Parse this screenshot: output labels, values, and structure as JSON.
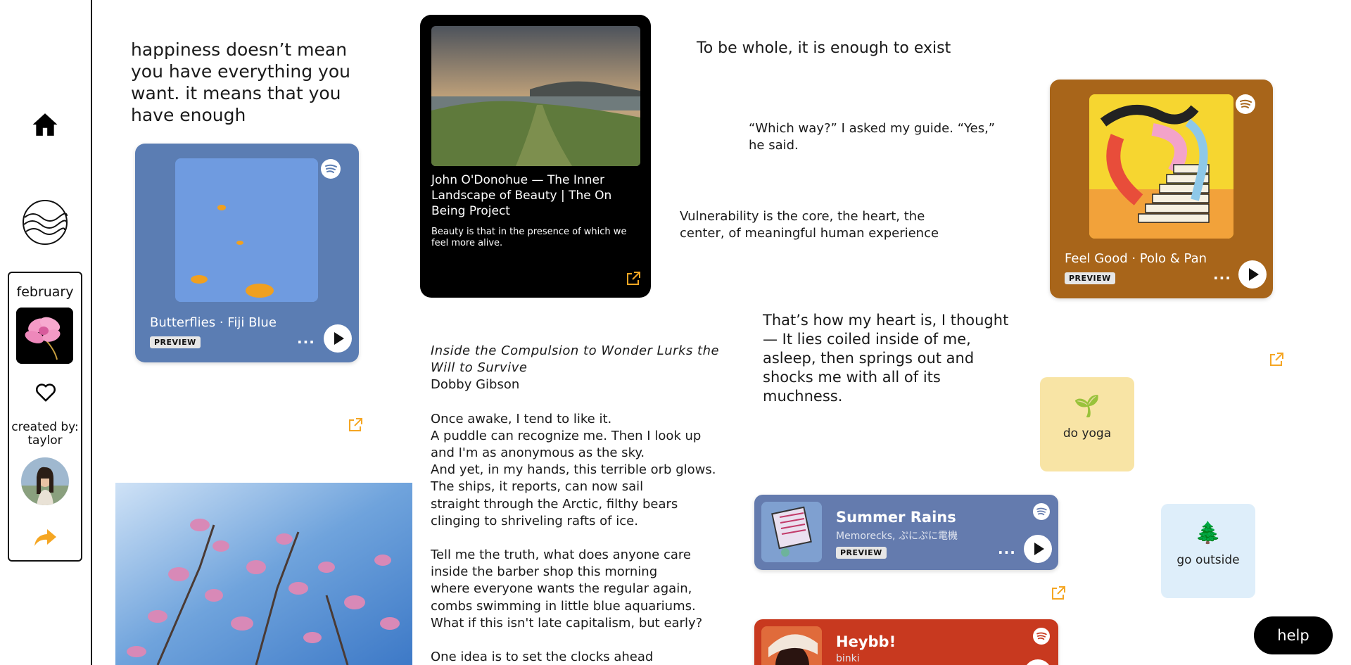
{
  "sidebar": {
    "month": "february",
    "created_by": "created by: taylor"
  },
  "quotes": {
    "happiness": "happiness doesn’t mean you have everything you want. it means that you have enough",
    "whole": "To be whole, it is enough to exist",
    "which_way": "“Which way?” I asked my guide. “Yes,” he said.",
    "vulnerability": "Vulnerability is the core, the heart, the center, of meaningful human experience",
    "heart": "That’s how my heart is, I thought— It lies coiled inside of me, asleep, then springs out and shocks me with all of its muchness."
  },
  "spotify": {
    "butterflies": {
      "title": "Butterflies · Fiji Blue",
      "badge": "PREVIEW"
    },
    "feelgood": {
      "title": "Feel Good · Polo & Pan",
      "badge": "PREVIEW"
    },
    "summer": {
      "title": "Summer Rains",
      "artist": "Memorecks, ぷにぷに電機",
      "badge": "PREVIEW"
    },
    "heybb": {
      "title": "Heybb!",
      "artist": "binki"
    }
  },
  "podcast": {
    "title": "John O'Donohue — The Inner Landscape of Beauty | The On Being Project",
    "description": "Beauty is that in the presence of which we feel more alive."
  },
  "poem": {
    "title": "Inside the Compulsion to Wonder Lurks the Will to Survive",
    "author": "Dobby Gibson",
    "stanza1": [
      "Once awake, I tend to like it.",
      "A puddle can recognize me. Then I look up",
      "and I'm as anonymous as the sky.",
      "And yet, in my hands, this terrible orb glows.",
      "The ships, it reports, can now sail",
      "straight through the Arctic, filthy bears",
      "clinging to shriveling rafts of ice."
    ],
    "stanza2": [
      "Tell me the truth, what does anyone care",
      "inside the barber shop this morning",
      "where everyone wants the regular again,",
      "combs swimming in little blue aquariums.",
      "What if this isn't late capitalism, but early?"
    ],
    "stanza3": [
      "One idea is to set the clocks ahead"
    ]
  },
  "todos": {
    "yoga": {
      "emoji": "🌱",
      "label": "do yoga"
    },
    "outside": {
      "emoji": "🌲",
      "label": "go outside"
    }
  },
  "help": {
    "label": "help"
  },
  "colors": {
    "accent_link": "#f5a623",
    "card_butterflies": "#5b7db3",
    "card_feelgood": "#a8651a",
    "card_summer": "#647bae",
    "card_heybb": "#c8391f",
    "todo_yoga": "#f8e4a5",
    "todo_outside": "#deeefa"
  },
  "icons": [
    "home-icon",
    "waves-logo-icon",
    "heart-icon",
    "share-arrow-icon",
    "spotify-icon",
    "play-icon",
    "more-dots-icon",
    "external-link-icon"
  ]
}
